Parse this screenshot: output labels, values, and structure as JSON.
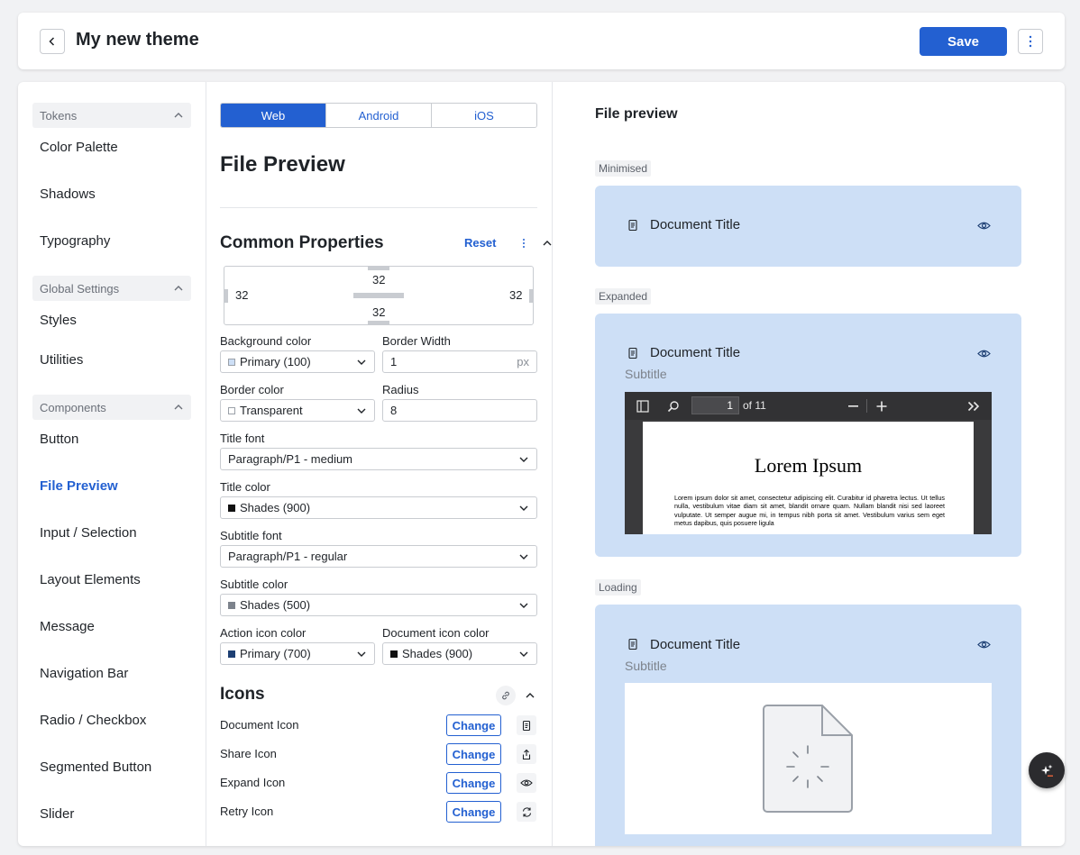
{
  "header": {
    "title": "My new theme",
    "save_label": "Save"
  },
  "sidebar": {
    "groups": [
      {
        "label": "Tokens",
        "items": [
          "Color Palette",
          "Shadows",
          "Typography"
        ]
      },
      {
        "label": "Global Settings",
        "items": [
          "Styles",
          "Utilities"
        ]
      },
      {
        "label": "Components",
        "items": [
          "Button",
          "File Preview",
          "Input / Selection",
          "Layout Elements",
          "Message",
          "Navigation Bar",
          "Radio / Checkbox",
          "Segmented Button",
          "Slider"
        ]
      }
    ],
    "active_item": "File Preview"
  },
  "config": {
    "platform_tabs": [
      "Web",
      "Android",
      "iOS"
    ],
    "active_tab": "Web",
    "title": "File Preview",
    "common_properties": {
      "title": "Common Properties",
      "reset_label": "Reset",
      "padding": {
        "top": "32",
        "left": "32",
        "right": "32",
        "bottom": "32"
      },
      "fields": {
        "background_color": {
          "label": "Background color",
          "value": "Primary (100)",
          "swatch": "#cddff6"
        },
        "border_width": {
          "label": "Border Width",
          "value": "1",
          "unit": "px"
        },
        "border_color": {
          "label": "Border color",
          "value": "Transparent",
          "swatch": "#ffffff"
        },
        "radius": {
          "label": "Radius",
          "value": "8"
        },
        "title_font": {
          "label": "Title font",
          "value": "Paragraph/P1 - medium"
        },
        "title_color": {
          "label": "Title color",
          "value": "Shades (900)",
          "swatch": "#111111"
        },
        "subtitle_font": {
          "label": "Subtitle font",
          "value": "Paragraph/P1 - regular"
        },
        "subtitle_color": {
          "label": "Subtitle color",
          "value": "Shades (500)",
          "swatch": "#7d838c"
        },
        "action_icon_color": {
          "label": "Action icon color",
          "value": "Primary (700)",
          "swatch": "#1d3f73"
        },
        "document_icon_color": {
          "label": "Document icon color",
          "value": "Shades (900)",
          "swatch": "#111111"
        }
      }
    },
    "icons": {
      "title": "Icons",
      "change_label": "Change",
      "rows": [
        {
          "label": "Document Icon",
          "icon": "document-icon"
        },
        {
          "label": "Share Icon",
          "icon": "share-icon"
        },
        {
          "label": "Expand Icon",
          "icon": "eye-icon"
        },
        {
          "label": "Retry Icon",
          "icon": "retry-icon"
        }
      ]
    }
  },
  "preview": {
    "heading": "File preview",
    "states": [
      {
        "tag": "Minimised",
        "title": "Document Title"
      },
      {
        "tag": "Expanded",
        "title": "Document Title",
        "subtitle": "Subtitle"
      },
      {
        "tag": "Loading",
        "title": "Document Title",
        "subtitle": "Subtitle"
      }
    ],
    "pdf": {
      "page_input": "1",
      "page_total": "of 11",
      "heading": "Lorem Ipsum",
      "body": "Lorem ipsum dolor sit amet, consectetur adipiscing elit. Curabitur id pharetra lectus. Ut tellus nulla, vestibulum vitae diam sit amet, blandit ornare quam. Nullam blandit nisi sed laoreet vulputate. Ut semper augue mi, in tempus nibh porta sit amet. Vestibulum varius sem eget metus dapibus, quis posuere ligula"
    }
  },
  "colors": {
    "accent": "#2360d1",
    "card_bg": "#cddff6"
  }
}
